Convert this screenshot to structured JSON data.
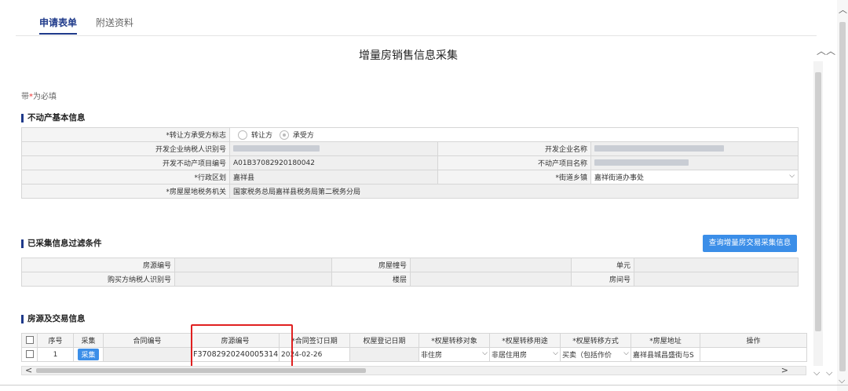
{
  "tabs": [
    "申请表单",
    "附送资料"
  ],
  "page_title": "增量房销售信息采集",
  "required_note": {
    "prefix": "带",
    "star": "*",
    "suffix": "为必填"
  },
  "sections": {
    "property_info": "不动产基本信息",
    "filter": "已采集信息过滤条件",
    "house_trade": "房源及交易信息"
  },
  "property": {
    "flag_label": "*转让方承受方标志",
    "flag_options": [
      "转让方",
      "承受方"
    ],
    "dev_taxid_label": "开发企业纳税人识别号",
    "dev_name_label": "开发企业名称",
    "project_no_label": "开发不动产项目编号",
    "project_no_value": "A01B37082920180042",
    "project_name_label": "不动产项目名称",
    "district_label": "*行政区划",
    "district_value": "嘉祥县",
    "street_label": "*街道乡镇",
    "street_value": "嘉祥街道办事处",
    "tax_org_label": "*房屋屋地税务机关",
    "tax_org_value": "国家税务总局嘉祥县税务局第二税务分局"
  },
  "filter": {
    "house_no": "房源编号",
    "building_no": "房屋幢号",
    "unit": "单元",
    "buyer_taxid": "购买方纳税人识别号",
    "floor": "楼层",
    "room_no": "房间号",
    "query_button": "查询增量房交易采集信息"
  },
  "grid": {
    "headers": [
      "序号",
      "采集",
      "合同编号",
      "房源编号",
      "*合同签订日期",
      "权屋登记日期",
      "*权屋转移对象",
      "*权屋转移用途",
      "*权屋转移方式",
      "*房屋地址",
      "操作"
    ],
    "row": {
      "index": "1",
      "collect": "采集",
      "contract_no": "",
      "house_no": "F37082920240005314",
      "sign_date": "2024-02-26",
      "reg_date": "",
      "object": "非住房",
      "usage": "非居住用房",
      "method": "买卖（包括作价",
      "address": "嘉祥县城昌盛街与S"
    }
  },
  "colors": {
    "accent": "#1f3a8a",
    "button": "#3b8ee8",
    "highlight": "#e02020"
  }
}
